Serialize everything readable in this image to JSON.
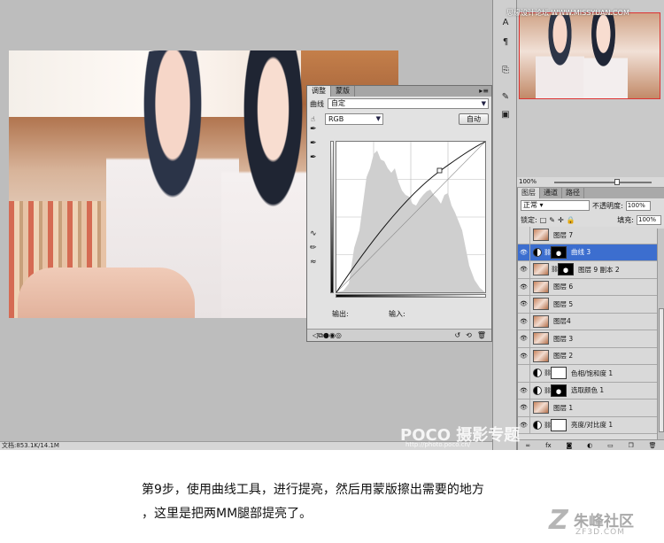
{
  "status": {
    "doc_info": "文档:853.1K/14.1M"
  },
  "navigator": {
    "zoom": "100%"
  },
  "adjust_panel": {
    "tabs": [
      "调整",
      "蒙版"
    ],
    "label": "曲线",
    "preset": "自定",
    "channel": "RGB",
    "auto_label": "自动",
    "output_label": "输出:",
    "input_label": "输入:"
  },
  "layers_panel": {
    "tabs": [
      "图层",
      "通道",
      "路径"
    ],
    "blend_mode": "正常",
    "opacity_label": "不透明度:",
    "opacity_value": "100%",
    "lock_label": "锁定:",
    "fill_label": "填充:",
    "fill_value": "100%",
    "layers": [
      {
        "name": "图层 7",
        "visible": false,
        "kind": "pixel",
        "selected": false
      },
      {
        "name": "曲线 3",
        "visible": true,
        "kind": "adjustment",
        "selected": true
      },
      {
        "name": "图层 9 副本 2",
        "visible": true,
        "kind": "masked",
        "selected": false
      },
      {
        "name": "图层 6",
        "visible": true,
        "kind": "pixel",
        "selected": false
      },
      {
        "name": "图层 5",
        "visible": true,
        "kind": "pixel",
        "selected": false
      },
      {
        "name": "图层4",
        "visible": true,
        "kind": "pixel",
        "selected": false
      },
      {
        "name": "图层 3",
        "visible": true,
        "kind": "pixel",
        "selected": false
      },
      {
        "name": "图层 2",
        "visible": true,
        "kind": "pixel",
        "selected": false
      },
      {
        "name": "色相/饱和度 1",
        "visible": false,
        "kind": "adjustment-white",
        "selected": false
      },
      {
        "name": "选取颜色 1",
        "visible": true,
        "kind": "adjustment-dark",
        "selected": false
      },
      {
        "name": "图层 1",
        "visible": true,
        "kind": "pixel",
        "selected": false
      },
      {
        "name": "亮度/对比度 1",
        "visible": true,
        "kind": "adjustment-white",
        "selected": false
      }
    ]
  },
  "watermarks": {
    "top": "思缘设计论坛 WWW.MISSYUAN.COM",
    "poco": "POCO 摄影专题",
    "poco_url": "http://photo.poco.cn/"
  },
  "caption": {
    "line1": "第9步，使用曲线工具，进行提亮，然后用蒙版擦出需要的地方",
    "line2": "，这里是把两MM腿部提亮了。"
  },
  "site_logo": {
    "name": "朱峰社区",
    "url": "ZF3D.COM"
  },
  "colors": {
    "selected_layer": "#3c6ecf",
    "nav_border": "#dd3333"
  }
}
